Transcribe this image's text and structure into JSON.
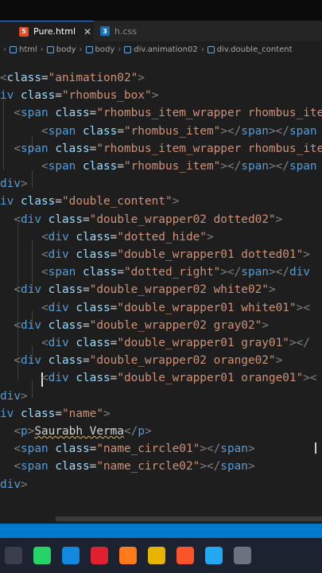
{
  "tabs": [
    {
      "label": "Pure.html",
      "icon": "html5-icon",
      "active": true,
      "close": "✕"
    },
    {
      "label": "h.css",
      "icon": "css3-icon",
      "active": false
    }
  ],
  "breadcrumb": [
    "html",
    "body",
    "body",
    "div.animation02",
    "div.double_content"
  ],
  "code_lines": [
    [
      [
        "t",
        "<"
      ],
      [
        "a",
        "class"
      ],
      [
        "x",
        "="
      ],
      [
        "s",
        "\"animation02\""
      ],
      [
        "t",
        ">"
      ]
    ],
    [
      [
        "n",
        "iv"
      ],
      [
        "x",
        " "
      ],
      [
        "a",
        "class"
      ],
      [
        "x",
        "="
      ],
      [
        "s",
        "\"rhombus_box\""
      ],
      [
        "t",
        ">"
      ]
    ],
    [
      [
        "x",
        "  "
      ],
      [
        "t",
        "<"
      ],
      [
        "n",
        "span"
      ],
      [
        "x",
        " "
      ],
      [
        "a",
        "class"
      ],
      [
        "x",
        "="
      ],
      [
        "s",
        "\"rhombus_item_wrapper rhombus_item"
      ]
    ],
    [
      [
        "x",
        "      "
      ],
      [
        "t",
        "<"
      ],
      [
        "n",
        "span"
      ],
      [
        "x",
        " "
      ],
      [
        "a",
        "class"
      ],
      [
        "x",
        "="
      ],
      [
        "s",
        "\"rhombus_item\""
      ],
      [
        "t",
        "></"
      ],
      [
        "n",
        "span"
      ],
      [
        "t",
        "></"
      ],
      [
        "n",
        "span"
      ]
    ],
    [
      [
        "x",
        "  "
      ],
      [
        "t",
        "<"
      ],
      [
        "n",
        "span"
      ],
      [
        "x",
        " "
      ],
      [
        "a",
        "class"
      ],
      [
        "x",
        "="
      ],
      [
        "s",
        "\"rhombus_item_wrapper rhombus_item"
      ]
    ],
    [
      [
        "x",
        "      "
      ],
      [
        "t",
        "<"
      ],
      [
        "n",
        "span"
      ],
      [
        "x",
        " "
      ],
      [
        "a",
        "class"
      ],
      [
        "x",
        "="
      ],
      [
        "s",
        "\"rhombus_item\""
      ],
      [
        "t",
        "></"
      ],
      [
        "n",
        "span"
      ],
      [
        "t",
        "></"
      ],
      [
        "n",
        "span"
      ]
    ],
    [
      [
        "n",
        "div"
      ],
      [
        "t",
        ">"
      ]
    ],
    [
      [
        "n",
        "iv"
      ],
      [
        "x",
        " "
      ],
      [
        "a",
        "class"
      ],
      [
        "x",
        "="
      ],
      [
        "s",
        "\"double_content\""
      ],
      [
        "t",
        ">"
      ]
    ],
    [
      [
        "x",
        "  "
      ],
      [
        "t",
        "<"
      ],
      [
        "n",
        "div"
      ],
      [
        "x",
        " "
      ],
      [
        "a",
        "class"
      ],
      [
        "x",
        "="
      ],
      [
        "s",
        "\"double_wrapper02 dotted02\""
      ],
      [
        "t",
        ">"
      ]
    ],
    [
      [
        "x",
        "      "
      ],
      [
        "t",
        "<"
      ],
      [
        "n",
        "div"
      ],
      [
        "x",
        " "
      ],
      [
        "a",
        "class"
      ],
      [
        "x",
        "="
      ],
      [
        "s",
        "\"dotted_hide\""
      ],
      [
        "t",
        ">"
      ]
    ],
    [
      [
        "x",
        "      "
      ],
      [
        "t",
        "<"
      ],
      [
        "n",
        "div"
      ],
      [
        "x",
        " "
      ],
      [
        "a",
        "class"
      ],
      [
        "x",
        "="
      ],
      [
        "s",
        "\"double_wrapper01 dotted01\""
      ],
      [
        "t",
        ">"
      ]
    ],
    [
      [
        "x",
        "      "
      ],
      [
        "t",
        "<"
      ],
      [
        "n",
        "span"
      ],
      [
        "x",
        " "
      ],
      [
        "a",
        "class"
      ],
      [
        "x",
        "="
      ],
      [
        "s",
        "\"dotted_right\""
      ],
      [
        "t",
        "></"
      ],
      [
        "n",
        "span"
      ],
      [
        "t",
        "></"
      ],
      [
        "n",
        "div"
      ]
    ],
    [
      [
        "x",
        "  "
      ],
      [
        "t",
        "<"
      ],
      [
        "n",
        "div"
      ],
      [
        "x",
        " "
      ],
      [
        "a",
        "class"
      ],
      [
        "x",
        "="
      ],
      [
        "s",
        "\"double_wrapper02 white02\""
      ],
      [
        "t",
        ">"
      ]
    ],
    [
      [
        "x",
        "      "
      ],
      [
        "t",
        "<"
      ],
      [
        "n",
        "div"
      ],
      [
        "x",
        " "
      ],
      [
        "a",
        "class"
      ],
      [
        "x",
        "="
      ],
      [
        "s",
        "\"double_wrapper01 white01\""
      ],
      [
        "t",
        "><"
      ]
    ],
    [
      [
        "x",
        "  "
      ],
      [
        "t",
        "<"
      ],
      [
        "n",
        "div"
      ],
      [
        "x",
        " "
      ],
      [
        "a",
        "class"
      ],
      [
        "x",
        "="
      ],
      [
        "s",
        "\"double_wrapper02 gray02\""
      ],
      [
        "t",
        ">"
      ]
    ],
    [
      [
        "x",
        "      "
      ],
      [
        "t",
        "<"
      ],
      [
        "n",
        "div"
      ],
      [
        "x",
        " "
      ],
      [
        "a",
        "class"
      ],
      [
        "x",
        "="
      ],
      [
        "s",
        "\"double_wrapper01 gray01\""
      ],
      [
        "t",
        "></"
      ]
    ],
    [
      [
        "x",
        "  "
      ],
      [
        "t",
        "<"
      ],
      [
        "n",
        "div"
      ],
      [
        "x",
        " "
      ],
      [
        "a",
        "class"
      ],
      [
        "x",
        "="
      ],
      [
        "s",
        "\"double_wrapper02 orange02\""
      ],
      [
        "t",
        ">"
      ]
    ],
    [
      [
        "x",
        "      "
      ],
      [
        "t",
        "<"
      ],
      [
        "n",
        "div"
      ],
      [
        "x",
        " "
      ],
      [
        "a",
        "class"
      ],
      [
        "x",
        "="
      ],
      [
        "s",
        "\"double_wrapper01 orange01\""
      ],
      [
        "t",
        "><"
      ]
    ],
    [
      [
        "n",
        "div"
      ],
      [
        "t",
        ">"
      ]
    ],
    [
      [
        "n",
        "iv"
      ],
      [
        "x",
        " "
      ],
      [
        "a",
        "class"
      ],
      [
        "x",
        "="
      ],
      [
        "s",
        "\"name\""
      ],
      [
        "t",
        ">"
      ]
    ],
    [
      [
        "x",
        "  "
      ],
      [
        "t",
        "<"
      ],
      [
        "n",
        "p"
      ],
      [
        "t",
        ">"
      ],
      [
        "u",
        "Saurabh Verma"
      ],
      [
        "t",
        "</"
      ],
      [
        "n",
        "p"
      ],
      [
        "t",
        ">"
      ]
    ],
    [
      [
        "x",
        "  "
      ],
      [
        "t",
        "<"
      ],
      [
        "n",
        "span"
      ],
      [
        "x",
        " "
      ],
      [
        "a",
        "class"
      ],
      [
        "x",
        "="
      ],
      [
        "s",
        "\"name_circle01\""
      ],
      [
        "t",
        "></"
      ],
      [
        "n",
        "span"
      ],
      [
        "t",
        ">"
      ]
    ],
    [
      [
        "x",
        "  "
      ],
      [
        "t",
        "<"
      ],
      [
        "n",
        "span"
      ],
      [
        "x",
        " "
      ],
      [
        "a",
        "class"
      ],
      [
        "x",
        "="
      ],
      [
        "s",
        "\"name_circle02\""
      ],
      [
        "t",
        "></"
      ],
      [
        "n",
        "span"
      ],
      [
        "t",
        ">"
      ]
    ],
    [
      [
        "n",
        "div"
      ],
      [
        "t",
        ">"
      ]
    ]
  ],
  "taskbar": [
    {
      "icon": "file-explorer-window-icon",
      "color": "#3a3f4b"
    },
    {
      "icon": "whatsapp-icon",
      "color": "#25d366"
    },
    {
      "icon": "edge-icon",
      "color": "#0f8ae0"
    },
    {
      "icon": "opera-icon",
      "color": "#e0202f"
    },
    {
      "icon": "firefox-icon",
      "color": "#ff7a1a"
    },
    {
      "icon": "chrome-icon",
      "color": "#e8b400"
    },
    {
      "icon": "brave-icon",
      "color": "#fb542b"
    },
    {
      "icon": "vscode-icon",
      "color": "#23a9f2"
    },
    {
      "icon": "settings-icon",
      "color": "#6b7280"
    }
  ]
}
